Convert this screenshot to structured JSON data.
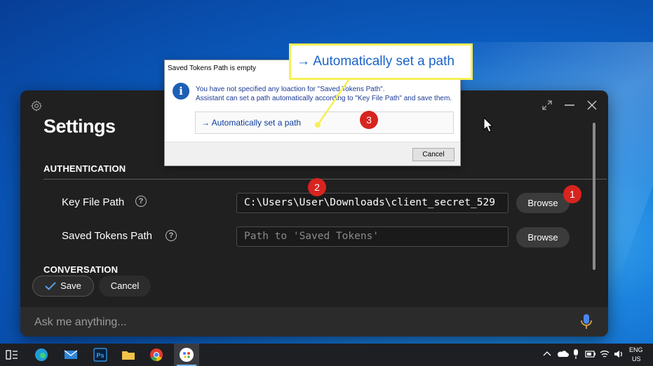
{
  "app": {
    "title": "Settings",
    "sections": {
      "authentication": "AUTHENTICATION",
      "conversation": "CONVERSATION"
    },
    "key_file": {
      "label": "Key File Path",
      "value": "C:\\Users\\User\\Downloads\\client_secret_529",
      "browse": "Browse"
    },
    "saved_tokens": {
      "label": "Saved Tokens Path",
      "placeholder": "Path to 'Saved Tokens'",
      "browse": "Browse"
    },
    "help_glyph": "?",
    "save_label": "Save",
    "cancel_label": "Cancel",
    "ask_placeholder": "Ask me anything..."
  },
  "dialog": {
    "title": "Saved Tokens Path is empty",
    "icon_glyph": "i",
    "message_line1": "You have not specified any loaction for \"Saved Tokens Path\".",
    "message_line2": "Assistant can set a path automatically according to \"Key File Path\" and save them.",
    "command_label": "→ Automatically set a path",
    "cancel_label": "Cancel"
  },
  "callout": {
    "text": "→ Automatically set a path"
  },
  "badges": [
    "1",
    "2",
    "3"
  ],
  "taskbar": {
    "apps": [
      "task-view",
      "edge",
      "mail",
      "photoshop",
      "file-explorer",
      "chrome",
      "assistant"
    ],
    "lang_line1": "ENG",
    "lang_line2": "US"
  },
  "colors": {
    "accent": "#1b63c9",
    "badge": "#d8241f",
    "highlight": "#f6f055"
  }
}
